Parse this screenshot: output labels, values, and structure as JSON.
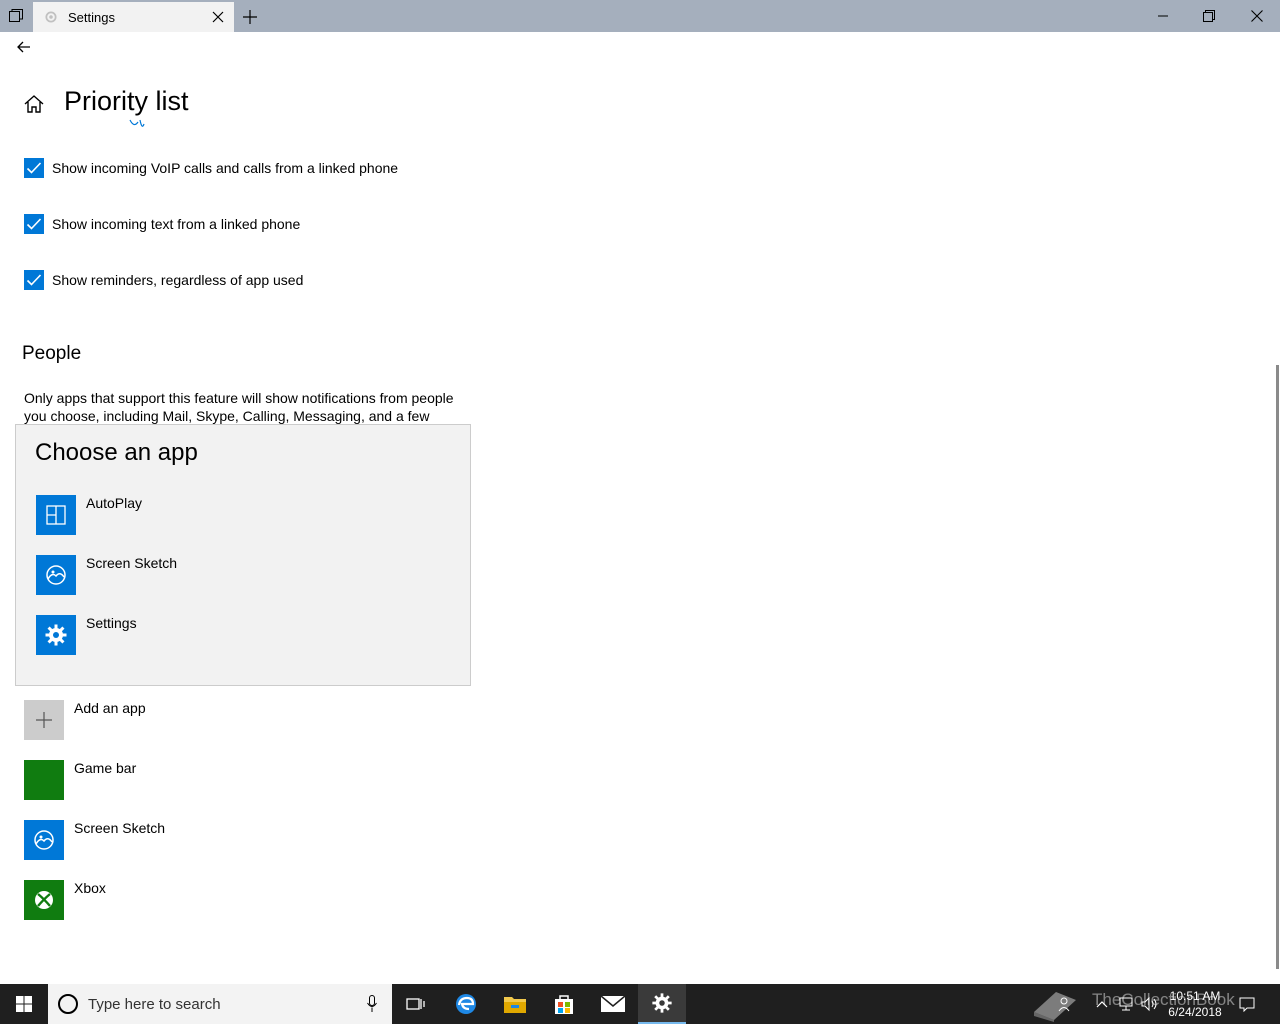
{
  "window": {
    "tab_title": "Settings"
  },
  "page": {
    "title": "Priority list"
  },
  "checkboxes": [
    {
      "label": "Show incoming VoIP calls and calls from a linked phone",
      "checked": true
    },
    {
      "label": "Show incoming text from a linked phone",
      "checked": true
    },
    {
      "label": "Show reminders, regardless of app used",
      "checked": true
    }
  ],
  "people": {
    "heading": "People",
    "description": "Only apps that support this feature will show notifications from people you choose, including Mail, Skype, Calling, Messaging, and a few others."
  },
  "flyout": {
    "title": "Choose an app",
    "items": [
      {
        "label": "AutoPlay",
        "icon": "autoplay-icon",
        "color": "#0078d7"
      },
      {
        "label": "Screen Sketch",
        "icon": "screen-sketch-icon",
        "color": "#0078d7"
      },
      {
        "label": "Settings",
        "icon": "gear-icon",
        "color": "#0078d7"
      }
    ]
  },
  "app_list": [
    {
      "label": "Add an app",
      "icon": "plus-icon",
      "color": "#cccccc"
    },
    {
      "label": "Game bar",
      "icon": "game-bar-icon",
      "color": "#107c10"
    },
    {
      "label": "Screen Sketch",
      "icon": "screen-sketch-icon",
      "color": "#0078d7"
    },
    {
      "label": "Xbox",
      "icon": "xbox-icon",
      "color": "#107c10"
    }
  ],
  "taskbar": {
    "search_placeholder": "Type here to search",
    "time": "10:51 AM",
    "date": "6/24/2018",
    "watermark": "TheCollectionBook"
  },
  "colors": {
    "accent": "#0078d7",
    "titlebar": "#a5afbd",
    "taskbar": "#1f1f1f"
  }
}
